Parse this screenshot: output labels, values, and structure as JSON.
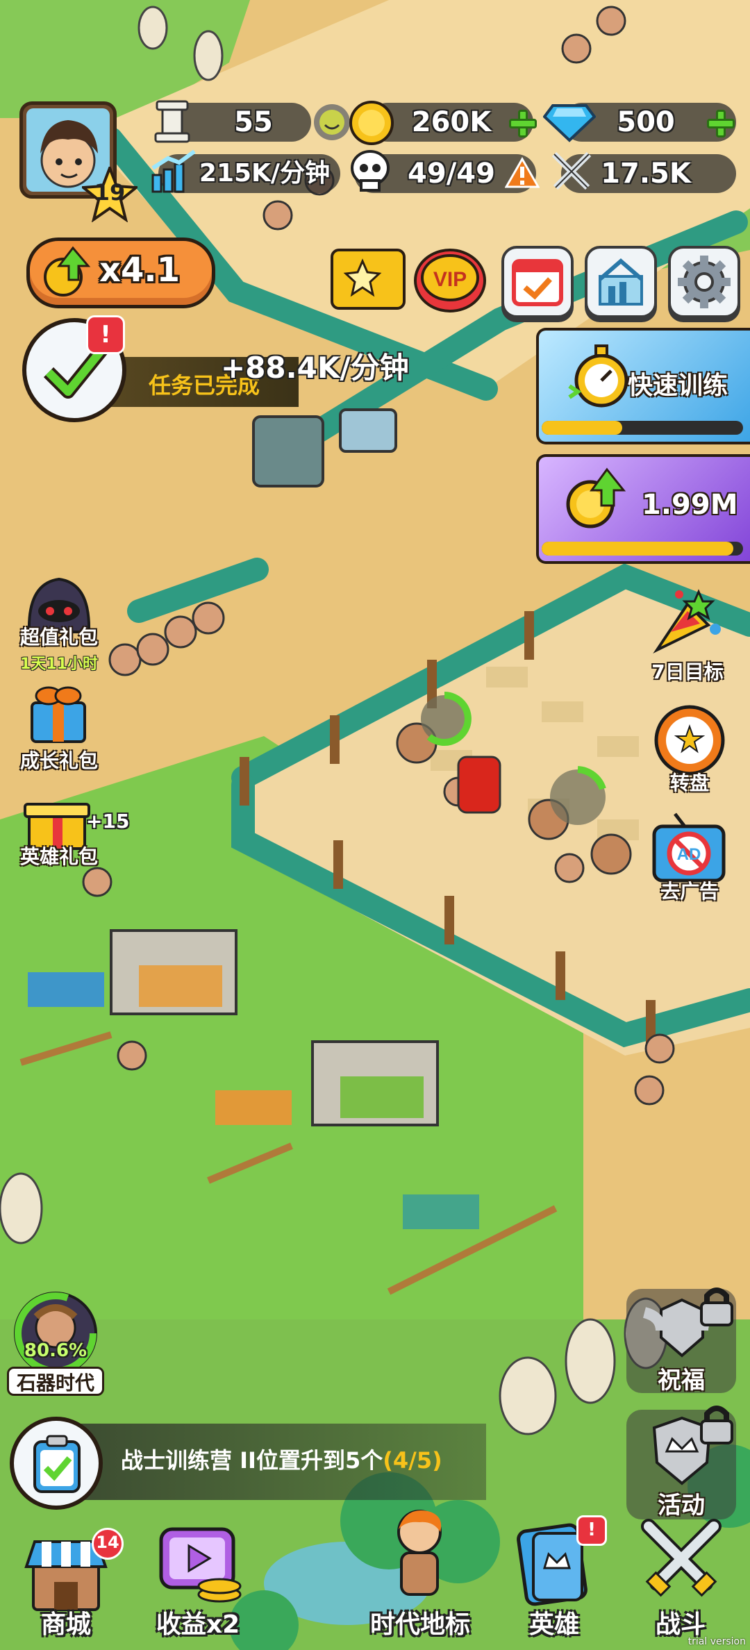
{
  "player": {
    "level": "19",
    "multiplier": "x4.1"
  },
  "resources": {
    "population": "55",
    "gold": "260K",
    "gems": "500",
    "income_rate": "215K/分钟",
    "troops": "49/49",
    "power": "17.5K"
  },
  "floating_income": "+88.4K/分钟",
  "task_banner": "任务已完成",
  "right_panels": {
    "fast_training": "快速训练",
    "fast_training_progress": 0.4,
    "coin_boost": "1.99M",
    "coin_boost_progress": 0.95
  },
  "left_menu": [
    {
      "label": "超值礼包",
      "sub": "1天11小时"
    },
    {
      "label": "成长礼包",
      "sub": ""
    },
    {
      "label": "英雄礼包",
      "sub": "+15"
    }
  ],
  "right_menu": [
    {
      "label": "7日目标"
    },
    {
      "label": "转盘"
    },
    {
      "label": "去广告"
    }
  ],
  "era": {
    "progress": "80.6%",
    "name": "石器时代"
  },
  "side_locked": [
    {
      "label": "祝福"
    },
    {
      "label": "活动"
    }
  ],
  "quest": {
    "text": "战士训练营 II位置升到5个",
    "progress": "(4/5)"
  },
  "bottom_nav": [
    {
      "label": "商城",
      "badge": "14"
    },
    {
      "label": "收益x2",
      "badge": ""
    },
    {
      "label": "时代地标",
      "badge": ""
    },
    {
      "label": "英雄",
      "badge": "!"
    },
    {
      "label": "战斗",
      "badge": ""
    }
  ],
  "watermark": "trial version",
  "colors": {
    "gold": "#f7c21a",
    "grass": "#7fc94e",
    "sand": "#e9c47b",
    "fence": "#2f9b82"
  }
}
